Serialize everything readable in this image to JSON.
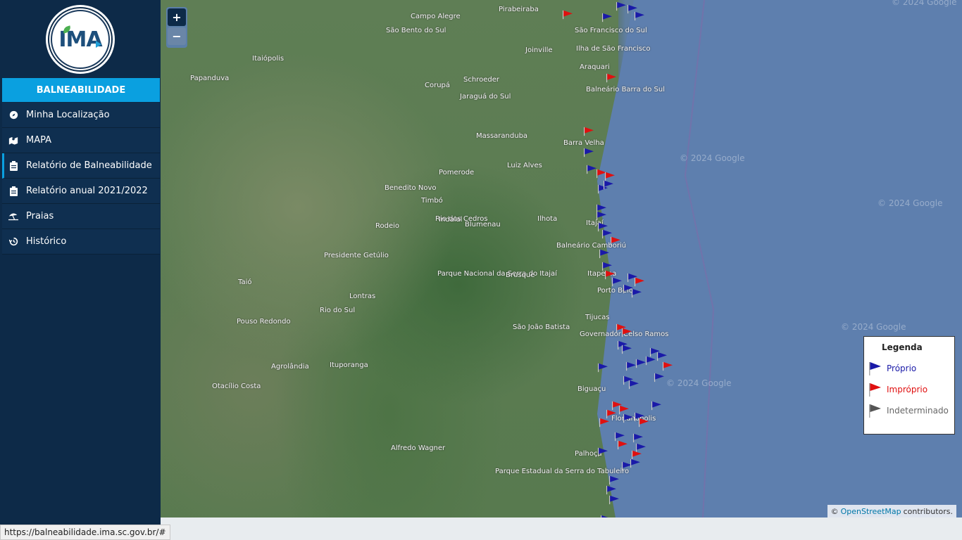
{
  "logo": {
    "text": "IMA"
  },
  "menu_title": "BALNEABILIDADE",
  "menu": [
    {
      "label": "Minha Localização",
      "icon": "compass-icon"
    },
    {
      "label": "MAPA",
      "icon": "map-icon"
    },
    {
      "label": "Relatório de Balneabilidade",
      "icon": "clipboard-icon"
    },
    {
      "label": "Relatório anual 2021/2022",
      "icon": "clipboard-icon"
    },
    {
      "label": "Praias",
      "icon": "umbrella-beach-icon"
    },
    {
      "label": "Histórico",
      "icon": "history-icon"
    }
  ],
  "map": {
    "zoom_in": "+",
    "zoom_out": "−",
    "cities": [
      "Campo Alegre",
      "São Bento do Sul",
      "Pirabeiraba",
      "São Francisco do Sul",
      "Ilha de São Francisco",
      "Joinville",
      "Itaiópolis",
      "Papanduva",
      "Schroeder",
      "Corupá",
      "Araquari",
      "Jaraguá do Sul",
      "Balneário Barra do Sul",
      "Massaranduba",
      "Barra Velha",
      "Luiz Alves",
      "Pomerode",
      "Benedito Novo",
      "Timbó",
      "Blumenau",
      "Ilhota",
      "Rio dos Cedros",
      "Indaial",
      "Rodeio",
      "Itajaí",
      "Balneário Camboriú",
      "Presidente Getúlio",
      "Parque Nacional da Serra do Itajaí",
      "Brusque",
      "Itapema",
      "Porto Belo",
      "Taió",
      "Lontras",
      "Rio do Sul",
      "Tijucas",
      "Pouso Redondo",
      "São João Batista",
      "Governador Celso Ramos",
      "Agrolândia",
      "Ituporanga",
      "Biguaçu",
      "Otacílio Costa",
      "Florianópolis",
      "Alfredo Wagner",
      "Palhoça",
      "Parque Estadual da Serra do Tabuleiro"
    ],
    "watermark": "© 2024 Google",
    "legend": {
      "title": "Legenda",
      "items": [
        {
          "label": "Próprio",
          "color": "#1a1aa8"
        },
        {
          "label": "Impróprio",
          "color": "#e01010"
        },
        {
          "label": "Indeterminado",
          "color": "#555555"
        }
      ]
    },
    "attribution": {
      "prefix": "©",
      "link": "OpenStreetMap",
      "suffix": "contributors."
    }
  },
  "status_url": "https://balneabilidade.ima.sc.gov.br/#"
}
